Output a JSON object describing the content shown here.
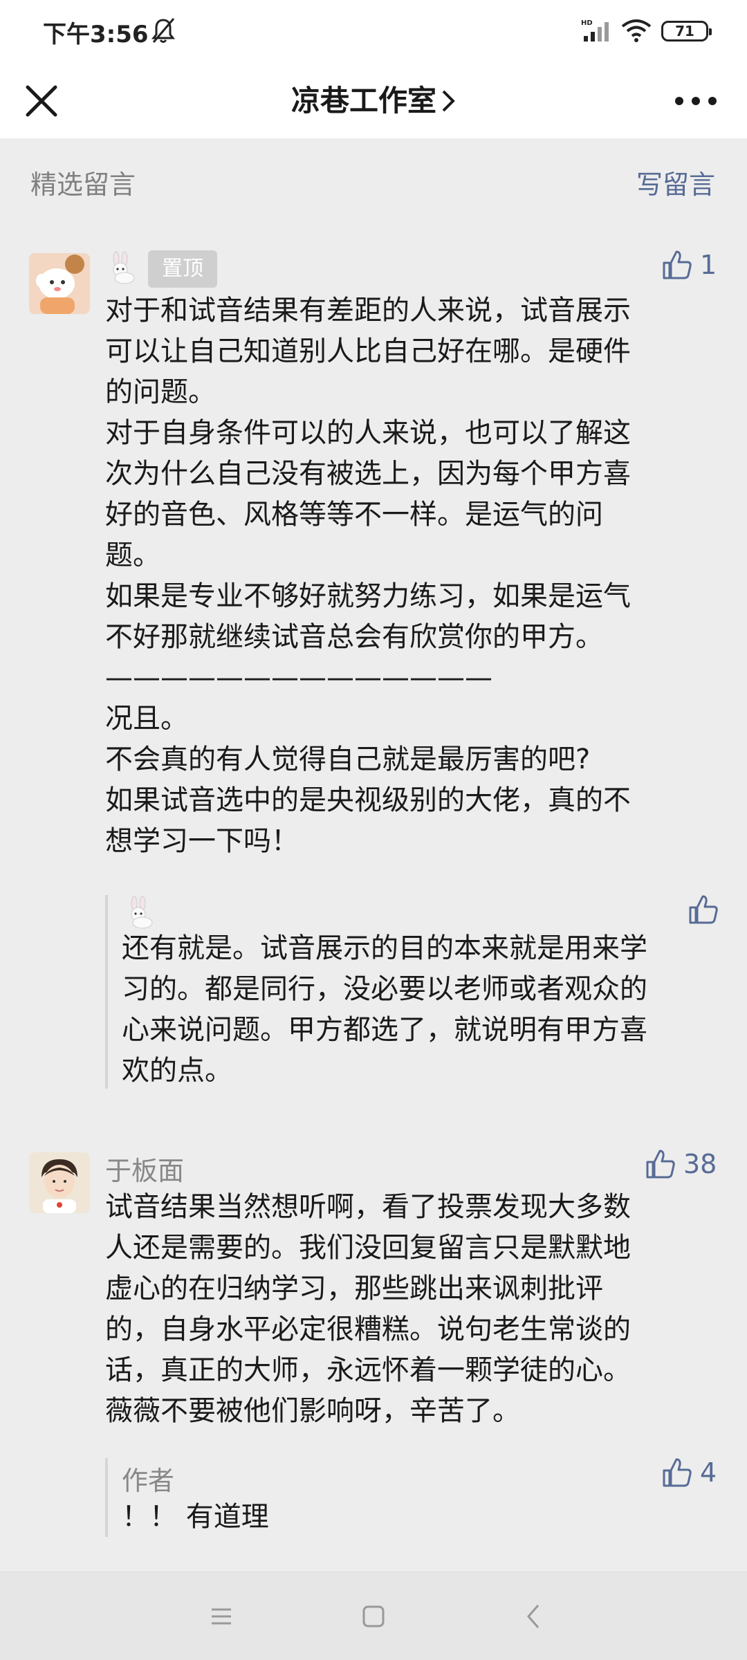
{
  "status_bar": {
    "time": "下午3:56",
    "battery": "71"
  },
  "nav": {
    "title": "凉巷工作室",
    "close_icon": "close-icon",
    "more_icon": "more-icon"
  },
  "section": {
    "label": "精选留言",
    "write_label": "写留言"
  },
  "comments": [
    {
      "nickname": "",
      "pinned_label": "置顶",
      "likes": "1",
      "text": "对于和试音结果有差距的人来说，试音展示\n可以让自己知道别人比自己好在哪。是硬件\n的问题。\n对于自身条件可以的人来说，也可以了解这\n次为什么自己没有被选上，因为每个甲方喜\n好的音色、风格等等不一样。是运气的问\n题。\n如果是专业不够好就努力练习，如果是运气\n不好那就继续试音总会有欣赏你的甲方。\n——————————————\n况且。\n不会真的有人觉得自己就是最厉害的吧?\n如果试音选中的是央视级别的大佬，真的不\n想学习一下吗！",
      "reply": {
        "name": "",
        "likes": "",
        "text": "还有就是。试音展示的目的本来就是用来学\n习的。都是同行，没必要以老师或者观众的\n心来说问题。甲方都选了，就说明有甲方喜\n欢的点。"
      }
    },
    {
      "nickname": "于板面",
      "likes": "38",
      "text": "试音结果当然想听啊，看了投票发现大多数\n人还是需要的。我们没回复留言只是默默地\n虚心的在归纳学习，那些跳出来讽刺批评\n的，自身水平必定很糟糕。说句老生常谈的\n话，真正的大师，永远怀着一颗学徒的心。\n薇薇不要被他们影响呀，辛苦了。",
      "reply": {
        "name": "作者",
        "likes": "4",
        "text": "！！ 有道理"
      }
    }
  ],
  "colors": {
    "link": "#576b95",
    "muted": "#888888",
    "background": "#ededed"
  }
}
